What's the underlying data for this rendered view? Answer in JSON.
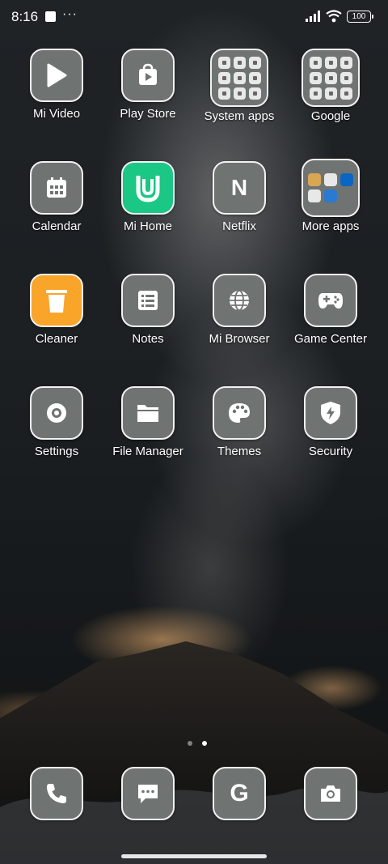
{
  "status_bar": {
    "time": "8:16",
    "dots": "···",
    "battery": "100"
  },
  "grid": [
    {
      "label": "Mi Video",
      "icon": "play-icon"
    },
    {
      "label": "Play Store",
      "icon": "play-store-icon"
    },
    {
      "label": "System apps",
      "icon": "folder-icon"
    },
    {
      "label": "Google",
      "icon": "folder-icon"
    },
    {
      "label": "Calendar",
      "icon": "calendar-icon"
    },
    {
      "label": "Mi Home",
      "icon": "mi-home-icon"
    },
    {
      "label": "Netflix",
      "icon": "netflix-icon",
      "glyph": "N"
    },
    {
      "label": "More apps",
      "icon": "folder-icon"
    },
    {
      "label": "Cleaner",
      "icon": "trash-icon"
    },
    {
      "label": "Notes",
      "icon": "notes-icon"
    },
    {
      "label": "Mi Browser",
      "icon": "globe-icon"
    },
    {
      "label": "Game Center",
      "icon": "gamepad-icon"
    },
    {
      "label": "Settings",
      "icon": "gear-icon"
    },
    {
      "label": "File Manager",
      "icon": "folder-file-icon"
    },
    {
      "label": "Themes",
      "icon": "palette-icon"
    },
    {
      "label": "Security",
      "icon": "shield-icon"
    }
  ],
  "dock": [
    {
      "name": "phone",
      "icon": "phone-icon"
    },
    {
      "name": "messages",
      "icon": "message-icon"
    },
    {
      "name": "google",
      "icon": "google-icon",
      "glyph": "G"
    },
    {
      "name": "camera",
      "icon": "camera-icon"
    }
  ],
  "pager": {
    "pages": 2,
    "current": 2
  },
  "colors": {
    "icon_bg": "#6f7472",
    "mi_home_green": "#1bc784",
    "cleaner_orange": "#f8a52a"
  }
}
